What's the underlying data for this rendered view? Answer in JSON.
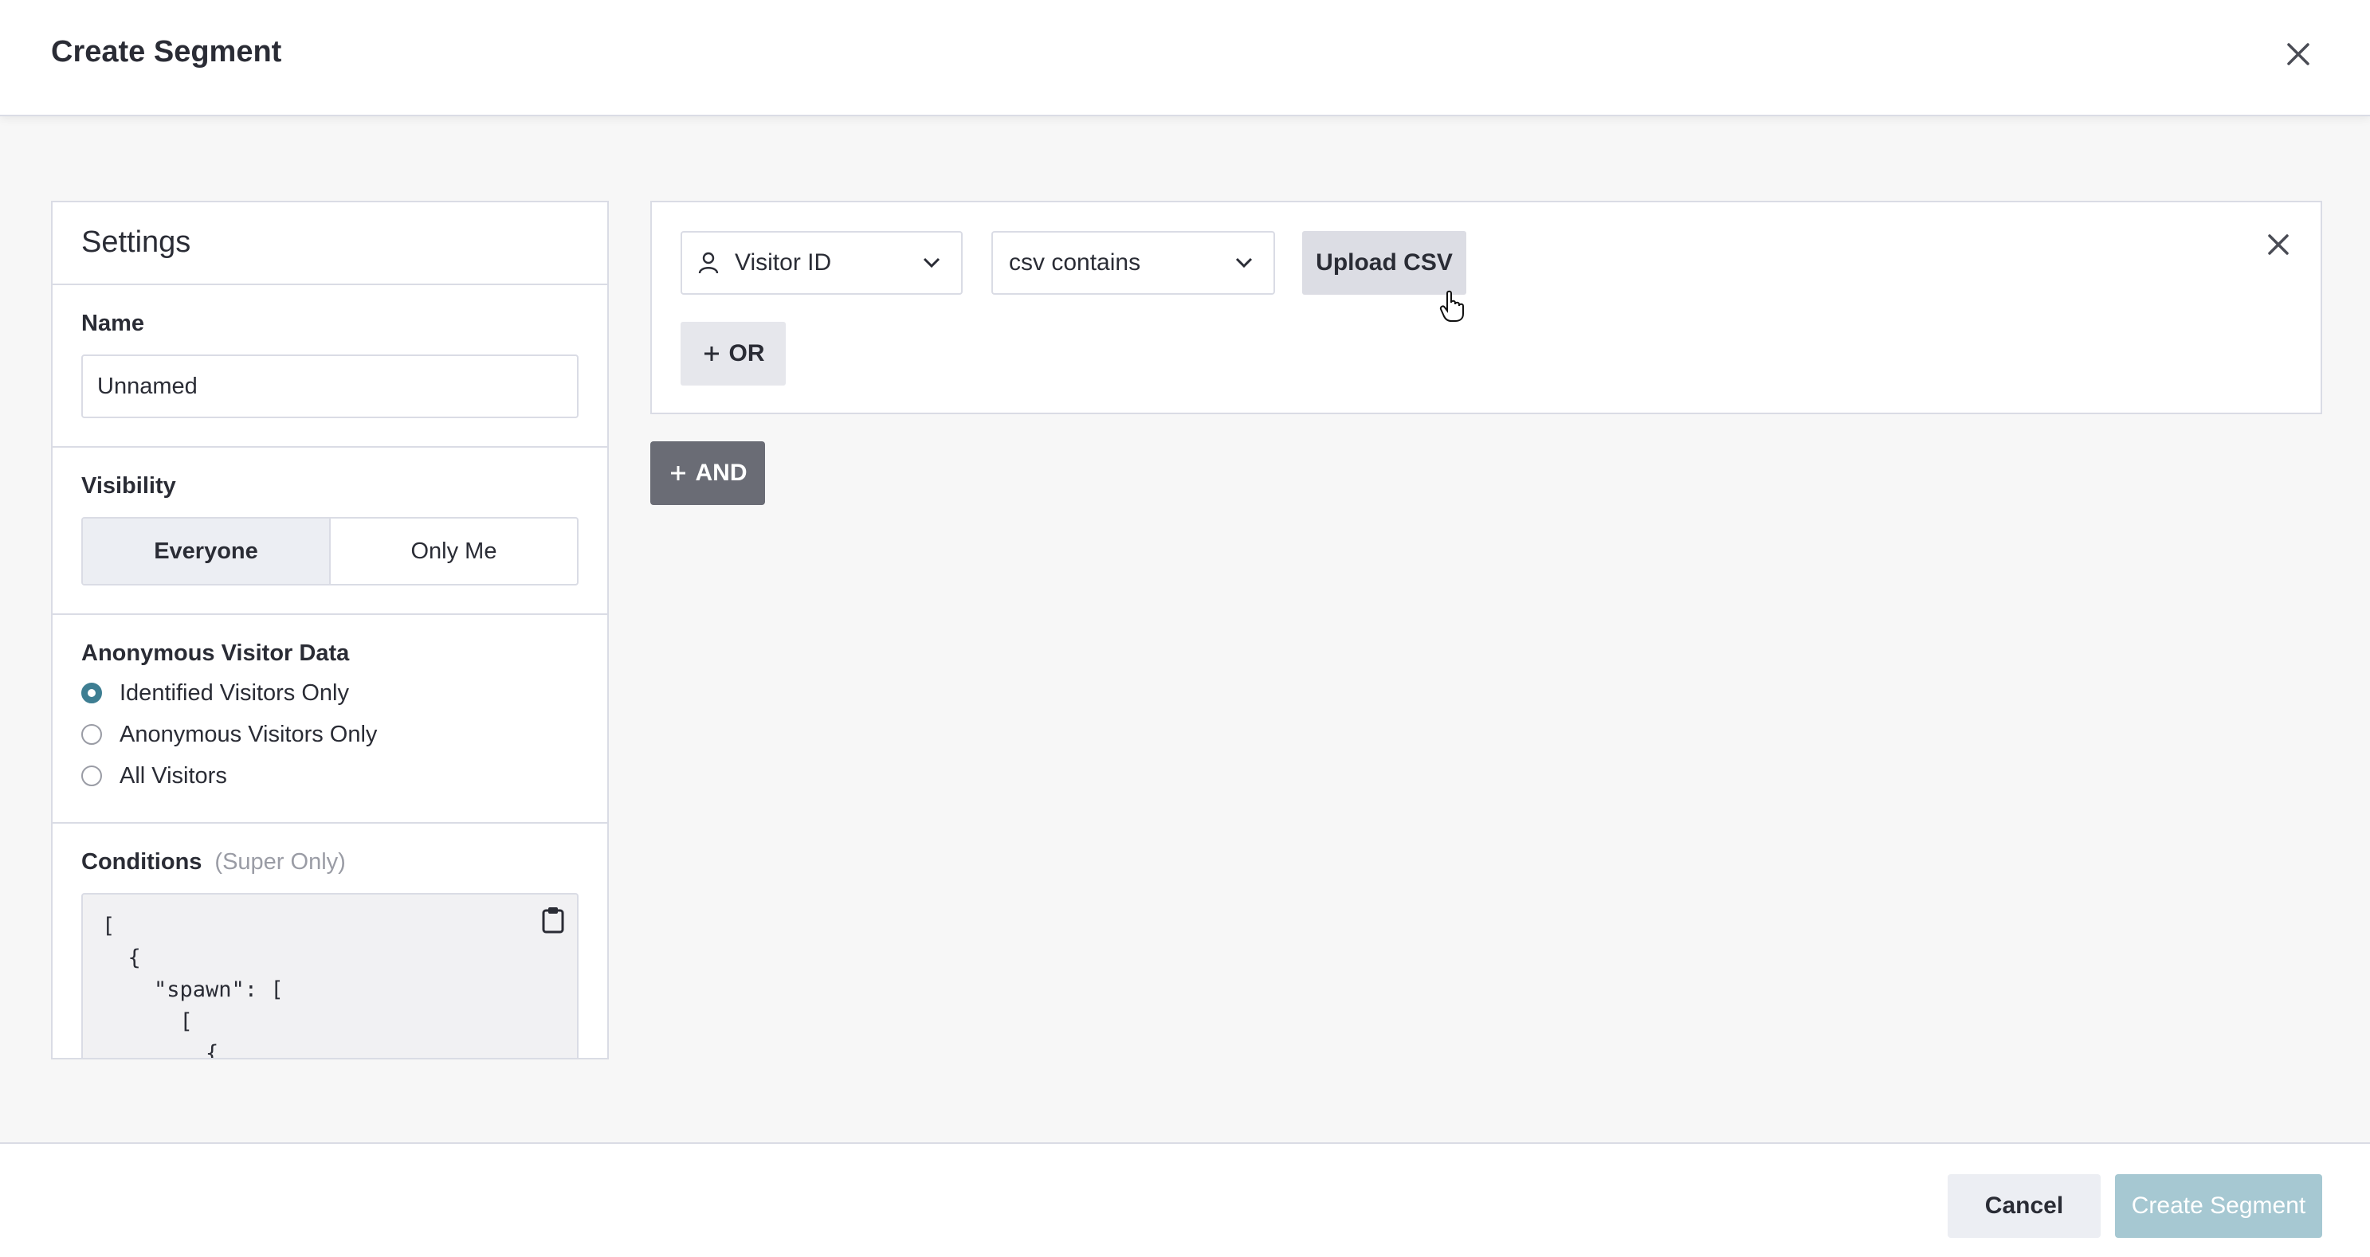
{
  "header": {
    "title": "Create Segment",
    "close_icon": "close-icon"
  },
  "settings": {
    "title": "Settings",
    "name": {
      "label": "Name",
      "value": "Unnamed"
    },
    "visibility": {
      "label": "Visibility",
      "options": [
        "Everyone",
        "Only Me"
      ],
      "selected": "Everyone"
    },
    "anonymous": {
      "label": "Anonymous Visitor Data",
      "options": [
        "Identified Visitors Only",
        "Anonymous Visitors Only",
        "All Visitors"
      ],
      "selected": "Identified Visitors Only",
      "accent_color": "#3e7e92"
    },
    "conditions": {
      "label": "Conditions",
      "note": "(Super Only)",
      "code": "[\n  {\n    \"spawn\": [\n      [\n        {",
      "copy_icon": "clipboard-icon"
    }
  },
  "rule": {
    "field_dropdown": {
      "icon": "person-icon",
      "value": "Visitor ID"
    },
    "operator_dropdown": {
      "value": "csv contains"
    },
    "upload_label": "Upload CSV",
    "or_label": "OR",
    "remove_icon": "close-icon"
  },
  "and_label": "AND",
  "footer": {
    "cancel_label": "Cancel",
    "create_label": "Create Segment",
    "create_color": "#a6c8d2"
  }
}
